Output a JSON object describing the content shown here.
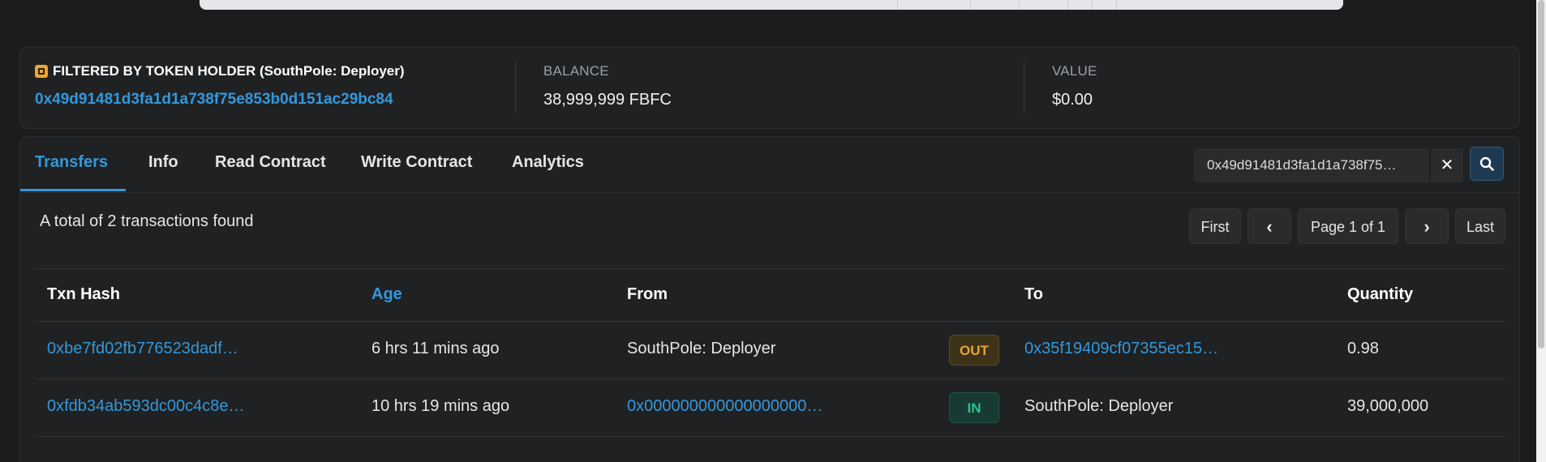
{
  "filter": {
    "label": "FILTERED BY TOKEN HOLDER (SouthPole: Deployer)",
    "address": "0x49d91481d3fa1d1a738f75e853b0d151ac29bc84",
    "balance_label": "BALANCE",
    "balance_value": "38,999,999 FBFC",
    "value_label": "VALUE",
    "value_value": "$0.00"
  },
  "tabs": [
    {
      "label": "Transfers",
      "active": true
    },
    {
      "label": "Info"
    },
    {
      "label": "Read Contract"
    },
    {
      "label": "Write Contract"
    },
    {
      "label": "Analytics"
    }
  ],
  "search": {
    "value": "0x49d91481d3fa1d1a738f75…",
    "clear_icon": "close-icon",
    "search_icon": "search-icon"
  },
  "summary": {
    "total_text": "A total of 2 transactions found"
  },
  "pager": {
    "first": "First",
    "prev": "‹",
    "page": "Page 1 of 1",
    "next": "›",
    "last": "Last"
  },
  "table": {
    "headers": {
      "hash": "Txn Hash",
      "age": "Age",
      "from": "From",
      "to": "To",
      "quantity": "Quantity"
    },
    "rows": [
      {
        "hash": "0xbe7fd02fb776523dadf…",
        "age": "6 hrs 11 mins ago",
        "from": "SouthPole: Deployer",
        "direction": "OUT",
        "to": "0x35f19409cf07355ec15…",
        "quantity": "0.98"
      },
      {
        "hash": "0xfdb34ab593dc00c4c8e…",
        "age": "10 hrs 19 mins ago",
        "from": "0x000000000000000000…",
        "direction": "IN",
        "to": "SouthPole: Deployer",
        "quantity": "39,000,000"
      }
    ]
  },
  "colors": {
    "background": "#1b1c1d",
    "card": "#202122",
    "link": "#3498db",
    "out_badge": "#e8a33a",
    "in_badge": "#2bc48a"
  }
}
